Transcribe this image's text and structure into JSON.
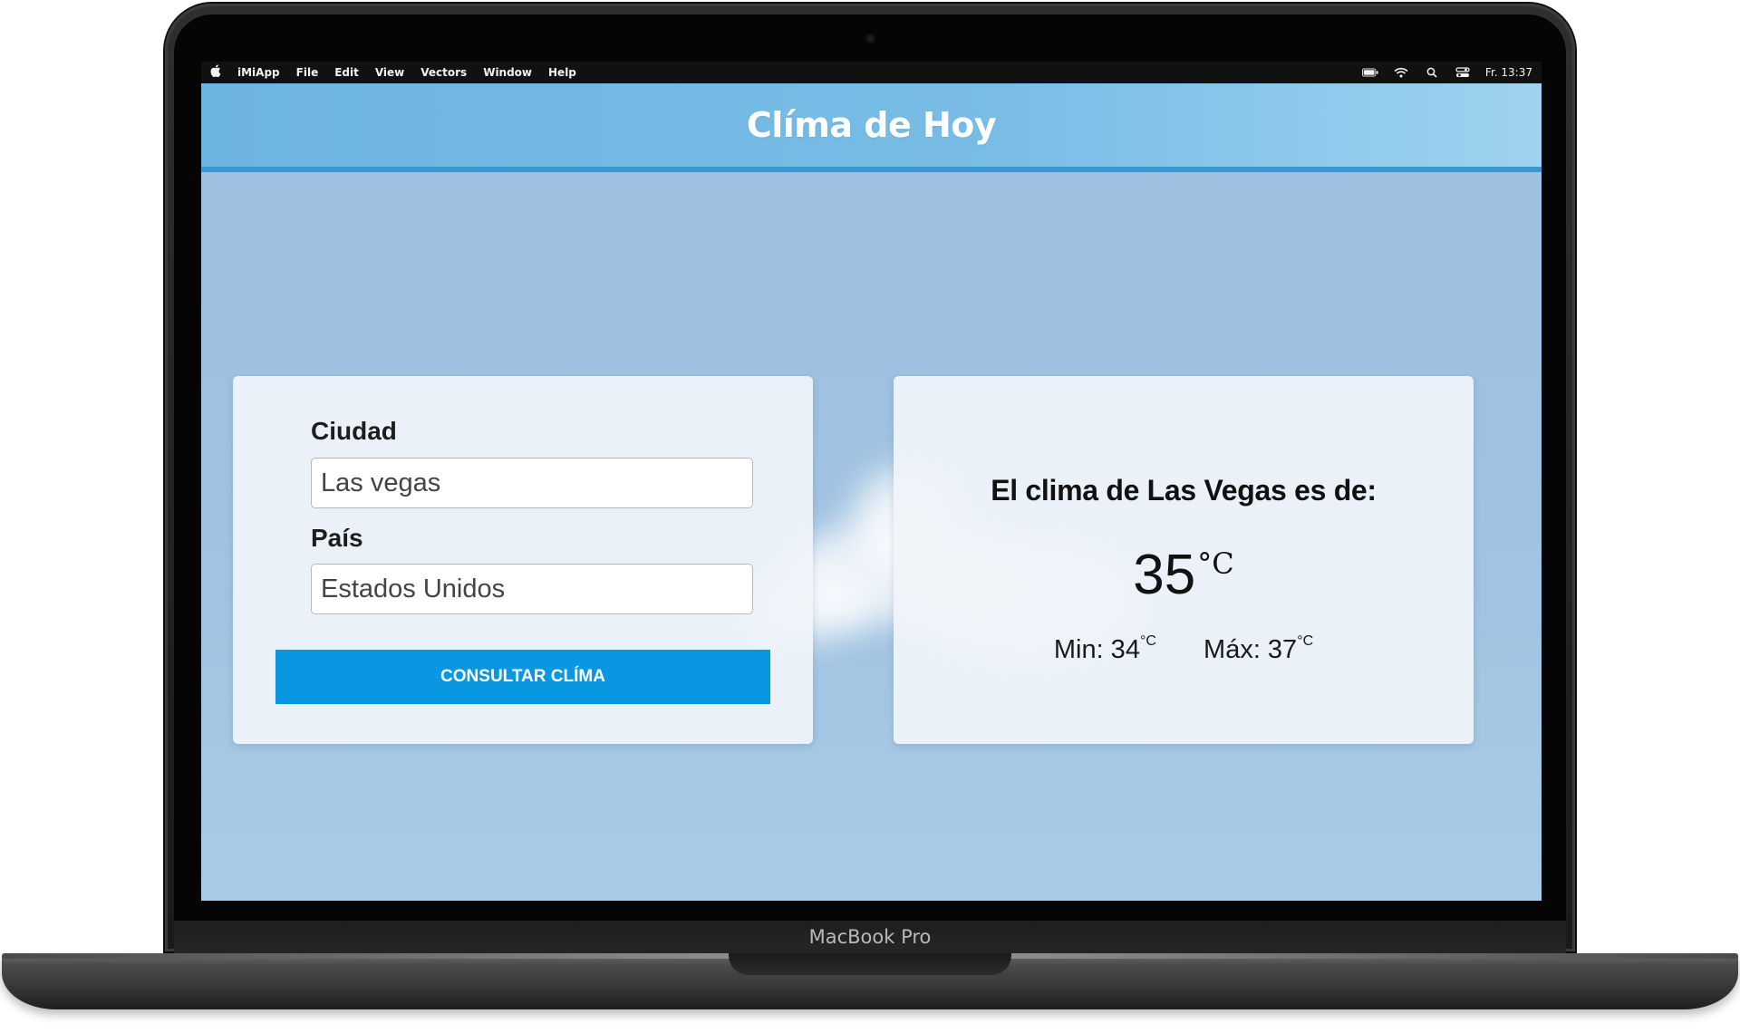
{
  "menubar": {
    "app_name": "iMiApp",
    "menus": [
      "File",
      "Edit",
      "View",
      "Vectors",
      "Window",
      "Help"
    ],
    "clock": "Fr. 13:37"
  },
  "app": {
    "title": "Clíma de Hoy"
  },
  "form": {
    "city_label": "Ciudad",
    "city_value": "Las vegas",
    "country_label": "País",
    "country_value": "Estados Unidos",
    "submit_label": "CONSULTAR CLÍMA"
  },
  "result": {
    "heading": "El clima de Las Vegas es de:",
    "temperature": "35",
    "unit": "°C",
    "min_label": "Min: 34",
    "max_label": "Máx: 37"
  },
  "device": {
    "brand_label": "MacBook Pro"
  },
  "colors": {
    "header": "#79bde6",
    "header_border": "#3d97d1",
    "button": "#0897e0",
    "sky": "#a2c4e2",
    "card": "#f0f4fa"
  },
  "icons": [
    "apple-icon",
    "battery-icon",
    "wifi-icon",
    "search-icon",
    "control-center-icon"
  ]
}
